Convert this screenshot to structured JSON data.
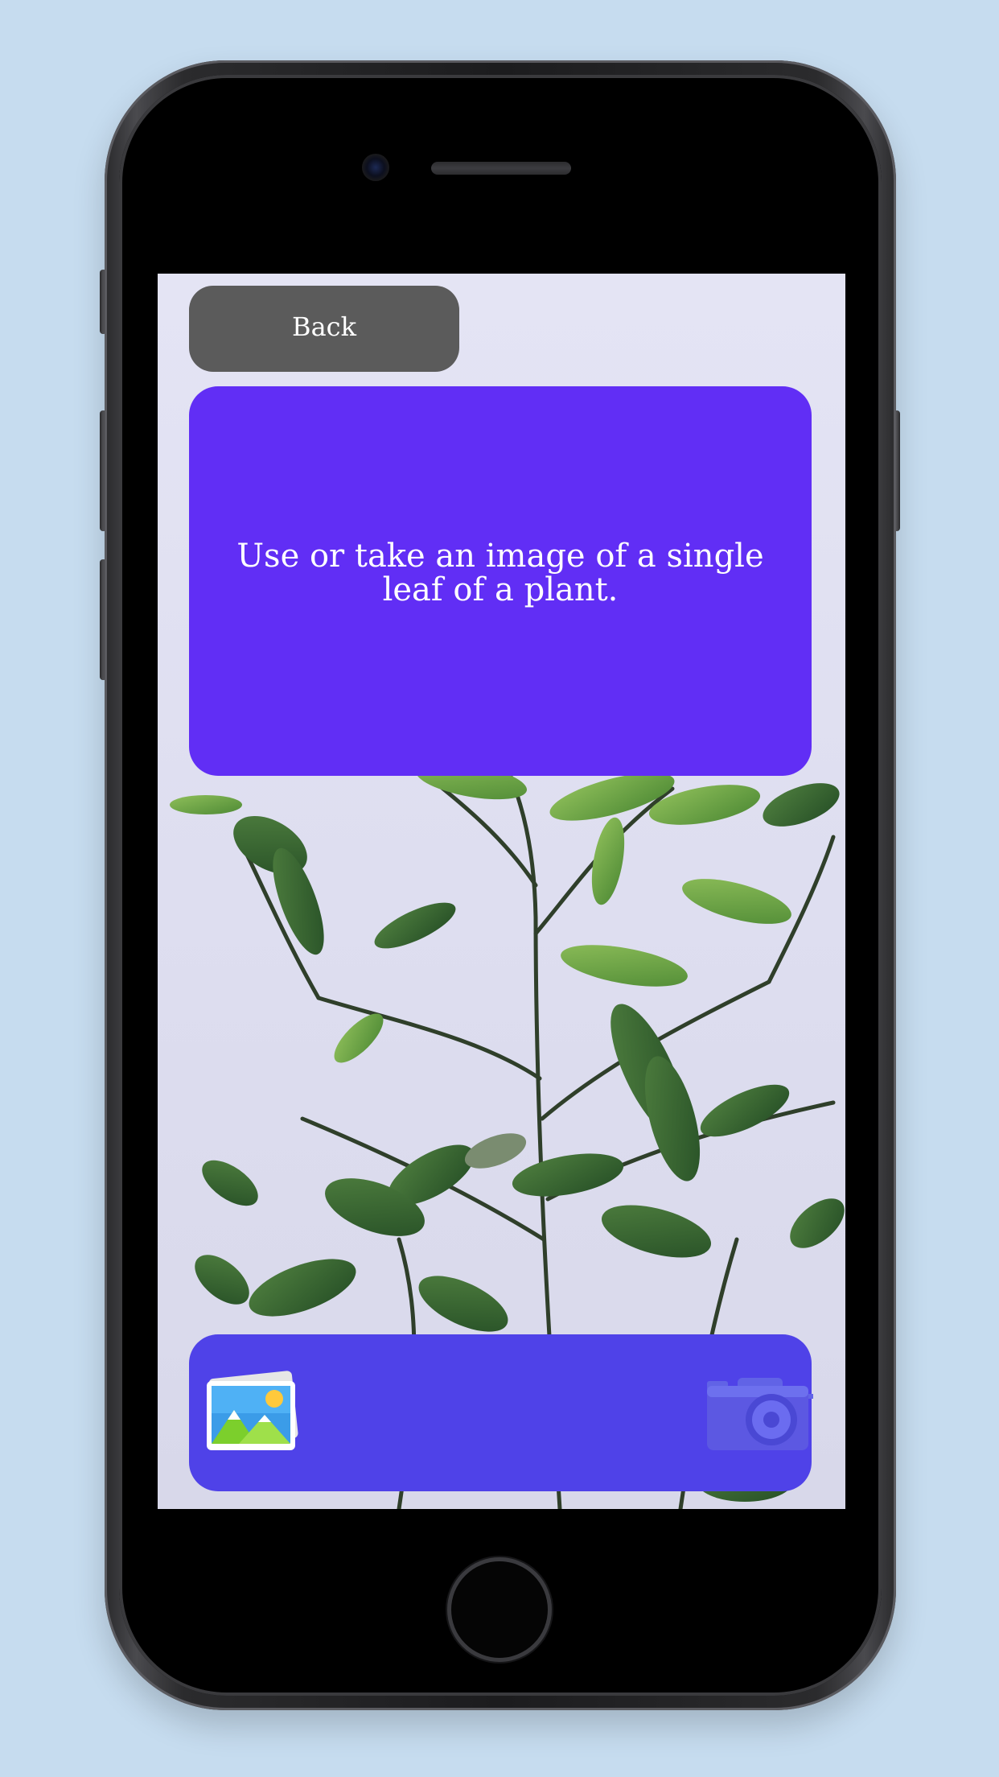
{
  "header": {
    "back_label": "Back"
  },
  "instruction": {
    "text": "Use or take an image of a single leaf of a plant."
  },
  "actions": {
    "gallery_icon": "gallery-icon",
    "camera_icon": "camera-icon"
  },
  "colors": {
    "page_background": "#c6dcef",
    "back_button": "#5b5b5b",
    "instruction_card": "#612ef5",
    "bottom_bar": "#4f42e8",
    "text": "#ffffff"
  }
}
